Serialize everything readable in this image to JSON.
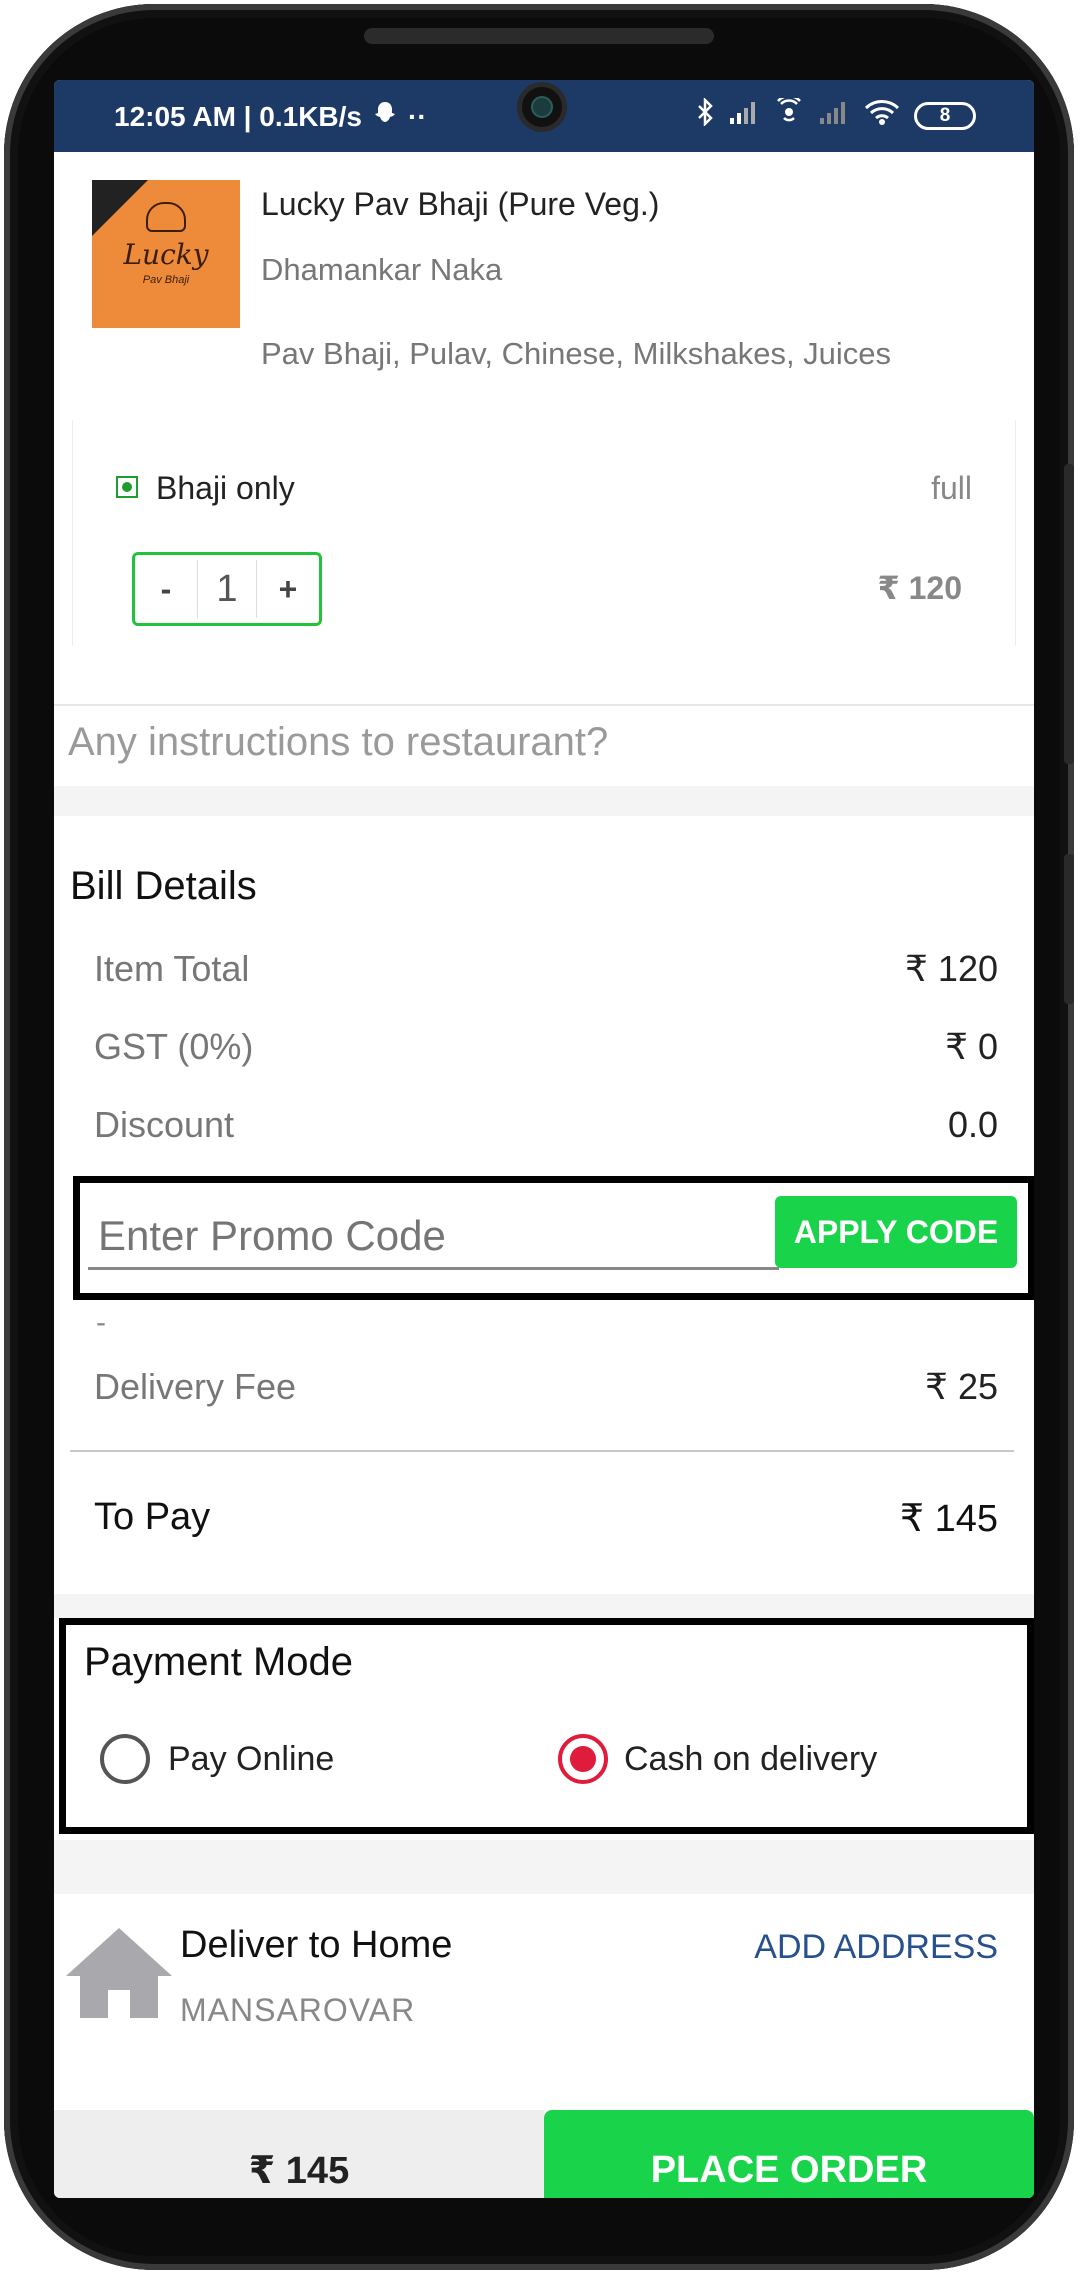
{
  "status_bar": {
    "time_and_speed": "12:05 AM | 0.1KB/s",
    "dots": "··",
    "battery": "8"
  },
  "restaurant": {
    "name": "Lucky Pav Bhaji (Pure Veg.)",
    "area": "Dhamankar Naka",
    "cuisines": "Pav Bhaji, Pulav, Chinese, Milkshakes, Juices",
    "logo_text": "Lucky",
    "logo_sub": "Pav Bhaji"
  },
  "cart": {
    "item_name": "Bhaji only",
    "variant": "full",
    "quantity": "1",
    "minus": "-",
    "plus": "+",
    "price": "₹ 120"
  },
  "instructions_placeholder": "Any instructions to restaurant?",
  "bill": {
    "title": "Bill Details",
    "rows": [
      {
        "label": "Item Total",
        "value": "₹ 120"
      },
      {
        "label": "GST (0%)",
        "value": "₹ 0"
      },
      {
        "label": "Discount",
        "value": "0.0"
      }
    ],
    "promo_placeholder": "Enter Promo Code",
    "apply_label": "APPLY CODE",
    "dash": "-",
    "delivery_label": "Delivery Fee",
    "delivery_value": "₹ 25",
    "to_pay_label": "To Pay",
    "to_pay_value": "₹ 145"
  },
  "payment": {
    "title": "Payment Mode",
    "options": [
      {
        "label": "Pay Online",
        "selected": false
      },
      {
        "label": "Cash on delivery",
        "selected": true
      }
    ]
  },
  "address": {
    "title": "Deliver to Home",
    "locality": "MANSAROVAR",
    "add_label": "ADD ADDRESS"
  },
  "footer": {
    "total": "₹ 145",
    "place_order": "PLACE ORDER"
  },
  "colors": {
    "accent_green": "#19d44a",
    "status_bar": "#1d3a66",
    "radio_selected": "#e01c3c",
    "link_blue": "#27508f"
  }
}
